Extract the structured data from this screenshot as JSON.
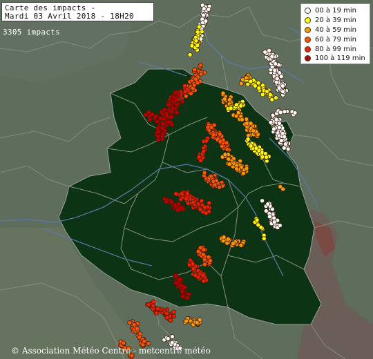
{
  "map": {
    "title_line1": "Carte des impacts -",
    "title_line2": "Mardi 03 Avril 2018 - 18H20",
    "impact_count": "3305 impacts",
    "credit": "© Association Météo Centre - metcentre météo"
  },
  "legend": [
    {
      "label": "00 à 19 min",
      "color": "#ffffff"
    },
    {
      "label": "20 à 39 min",
      "color": "#ffff00"
    },
    {
      "label": "40 à 59 min",
      "color": "#ff9900"
    },
    {
      "label": "60 à 79 min",
      "color": "#ff5500"
    },
    {
      "label": "80 à 99 min",
      "color": "#ee2200"
    },
    {
      "label": "100 à 119 min",
      "color": "#bb0000"
    }
  ],
  "colors": {
    "terrain": "#5b6b5a",
    "region": "#0c3313",
    "borders": "#8a8f8a",
    "rivers": "#5d7aa8"
  }
}
